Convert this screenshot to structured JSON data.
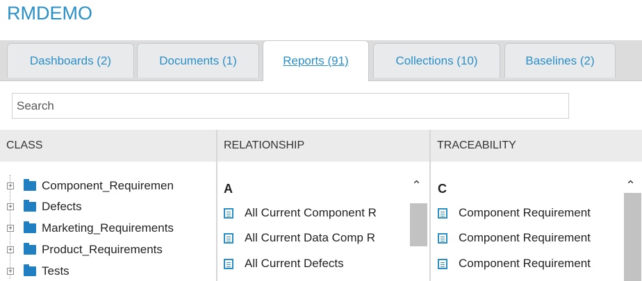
{
  "project": {
    "title": "RMDEMO"
  },
  "tabs": [
    {
      "label": "Dashboards (2)",
      "active": false
    },
    {
      "label": "Documents (1)",
      "active": false
    },
    {
      "label": "Reports (91)",
      "active": true
    },
    {
      "label": "Collections (10)",
      "active": false
    },
    {
      "label": "Baselines (2)",
      "active": false
    }
  ],
  "search": {
    "placeholder": "Search"
  },
  "columns": {
    "class": {
      "header": "CLASS",
      "items": [
        "Component_Requiremen",
        "Defects",
        "Marketing_Requirements",
        "Product_Requirements",
        "Tests"
      ]
    },
    "relationship": {
      "header": "RELATIONSHIP",
      "group": "A",
      "items": [
        "All Current Component R",
        "All Current Data Comp R",
        "All Current Defects"
      ]
    },
    "traceability": {
      "header": "TRACEABILITY",
      "group": "C",
      "items": [
        "Component Requirement",
        "Component Requirement",
        "Component Requirement"
      ]
    }
  },
  "colors": {
    "accent": "#2a8fc7",
    "folder": "#1f7fc1"
  }
}
